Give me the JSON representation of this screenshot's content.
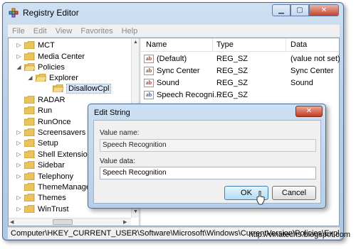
{
  "window": {
    "title": "Registry Editor"
  },
  "menu": [
    "File",
    "Edit",
    "View",
    "Favorites",
    "Help"
  ],
  "tree": [
    {
      "label": "MCT",
      "toggle": "▷"
    },
    {
      "label": "Media Center",
      "toggle": "▷"
    },
    {
      "label": "Policies",
      "toggle": "◢"
    },
    {
      "label": "Explorer",
      "toggle": "◢"
    },
    {
      "label": "DisallowCpl",
      "toggle": ""
    },
    {
      "label": "RADAR",
      "toggle": ""
    },
    {
      "label": "Run",
      "toggle": ""
    },
    {
      "label": "RunOnce",
      "toggle": ""
    },
    {
      "label": "Screensavers",
      "toggle": "▷"
    },
    {
      "label": "Setup",
      "toggle": "▷"
    },
    {
      "label": "Shell Extensions",
      "toggle": "▷"
    },
    {
      "label": "Sidebar",
      "toggle": "▷"
    },
    {
      "label": "Telephony",
      "toggle": "▷"
    },
    {
      "label": "ThemeManager",
      "toggle": ""
    },
    {
      "label": "Themes",
      "toggle": "▷"
    },
    {
      "label": "WinTrust",
      "toggle": "▷"
    }
  ],
  "list": {
    "columns": [
      "Name",
      "Type",
      "Data"
    ],
    "rows": [
      {
        "icon": "ab",
        "name": "(Default)",
        "type": "REG_SZ",
        "data": "(value not set)"
      },
      {
        "icon": "ab",
        "name": "Sync Center",
        "type": "REG_SZ",
        "data": "Sync Center"
      },
      {
        "icon": "ab",
        "name": "Sound",
        "type": "REG_SZ",
        "data": "Sound"
      },
      {
        "icon": "ab",
        "name": "Speech Recogni...",
        "type": "REG_SZ",
        "data": ""
      }
    ]
  },
  "status": "Computer\\HKEY_CURRENT_USER\\Software\\Microsoft\\Windows\\CurrentVersion\\Policies\\Explorer\\D",
  "dialog": {
    "title": "Edit String",
    "value_name_label": "Value name:",
    "value_name": "Speech Recognition",
    "value_data_label": "Value data:",
    "value_data": "Speech Recognition",
    "ok": "OK",
    "cancel": "Cancel"
  },
  "watermark": "http://vinatechs.blogspot.com",
  "colors": {
    "accent": "#3c7fb1",
    "folder": "#e8c45a",
    "close": "#c43a22"
  }
}
